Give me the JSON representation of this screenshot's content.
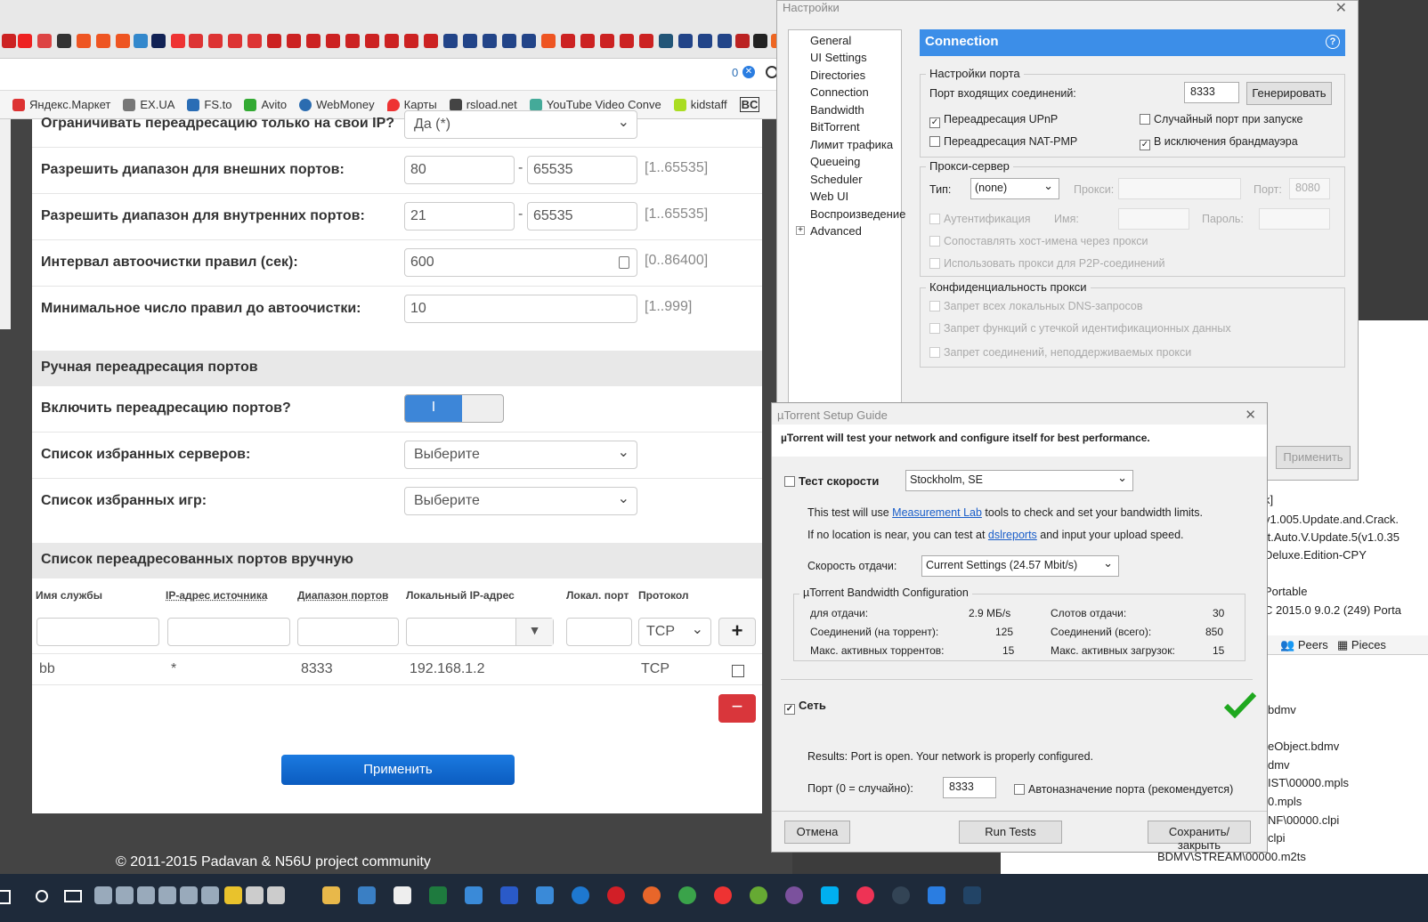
{
  "browser": {
    "counter": "0",
    "bookmarks": [
      {
        "label": "Яндекс.Маркет",
        "color": "#d33"
      },
      {
        "label": "EX.UA",
        "color": "#777"
      },
      {
        "label": "FS.to",
        "color": "#2a6db5"
      },
      {
        "label": "Avito",
        "color": "#3a3"
      },
      {
        "label": "WebMoney",
        "color": "#2b6cb0"
      },
      {
        "label": "Карты",
        "color": "#e33"
      },
      {
        "label": "rsload.net",
        "color": "#444"
      },
      {
        "label": "YouTube Video Conve",
        "color": "#4a9"
      },
      {
        "label": "kidstaff",
        "color": "#ad2"
      },
      {
        "label": "BC",
        "color": "#333"
      }
    ]
  },
  "router": {
    "row_restrict": {
      "label": "Ограничивать переадресацию только на свои IP?",
      "value": "Да (*)"
    },
    "row_ext": {
      "label": "Разрешить диапазон для внешних портов:",
      "from": "80",
      "to": "65535",
      "range": "[1..65535]"
    },
    "row_int": {
      "label": "Разрешить диапазон для внутренних портов:",
      "from": "21",
      "to": "65535",
      "range": "[1..65535]"
    },
    "row_interval": {
      "label": "Интервал автоочистки правил (сек):",
      "value": "600",
      "range": "[0..86400]"
    },
    "row_min": {
      "label": "Минимальное число правил до автоочистки:",
      "value": "10",
      "range": "[1..999]"
    },
    "section_manual": "Ручная переадресация портов",
    "row_enable": {
      "label": "Включить переадресацию портов?",
      "toggle": "I"
    },
    "row_servers": {
      "label": "Список избранных серверов:",
      "value": "Выберите"
    },
    "row_games": {
      "label": "Список избранных игр:",
      "value": "Выберите"
    },
    "section_list": "Список переадресованных портов вручную",
    "columns": [
      "Имя службы",
      "IP-адрес источника",
      "Диапазон портов",
      "Локальный IP-адрес",
      "Локал. порт",
      "Протокол"
    ],
    "new_protocol": "TCP",
    "entry": {
      "name": "bb",
      "src": "*",
      "range": "8333",
      "local_ip": "192.168.1.2",
      "protocol": "TCP"
    },
    "apply": "Применить",
    "footer": "© 2011-2015 Padavan & N56U project community"
  },
  "settings": {
    "title": "Настройки",
    "tree": [
      "General",
      "UI Settings",
      "Directories",
      "Connection",
      "Bandwidth",
      "BitTorrent",
      "Лимит трафика",
      "Queueing",
      "Scheduler",
      "Web UI",
      "Воспроизведение",
      "Advanced"
    ],
    "header": "Connection",
    "port_group": "Настройки порта",
    "incoming_label": "Порт входящих соединений:",
    "incoming_value": "8333",
    "generate": "Генерировать",
    "upnp": "Переадресация UPnP",
    "random_port": "Случайный порт при запуске",
    "natpmp": "Переадресация NAT-PMP",
    "firewall": "В исключения брандмауэра",
    "proxy_group": "Прокси-сервер",
    "type_label": "Тип:",
    "type_value": "(none)",
    "proxy_label": "Прокси:",
    "port_label": "Порт:",
    "port_value": "8080",
    "auth": "Аутентификация",
    "name_label": "Имя:",
    "pass_label": "Пароль:",
    "hostnames": "Сопоставлять хост-имена через прокси",
    "p2p": "Использовать прокси для P2P-соединений",
    "privacy_group": "Конфиденциальность прокси",
    "dns": "Запрет всех локальных DNS-запросов",
    "leak": "Запрет функций с утечкой идентификационных данных",
    "unsupported": "Запрет соединений, неподдерживаемых прокси",
    "apply": "Применить"
  },
  "behind": {
    "lines": [
      "k]",
      "v1.005.Update.and.Crack.",
      "ft.Auto.V.Update.5(v1.0.35",
      "Deluxe.Edition-CPY",
      "Portable",
      "C 2015.0 9.0.2 (249) Porta"
    ],
    "tabs": [
      "Peers",
      "Pieces"
    ],
    "files": [
      "bdmv",
      "eObject.bdmv",
      "dmv",
      "IST\\00000.mpls",
      "0.mpls",
      "NF\\00000.clpi",
      "clpi",
      "BDMV\\STREAM\\00000.m2ts"
    ]
  },
  "guide": {
    "title": "µTorrent Setup Guide",
    "heading": "µTorrent will test your network and configure itself for best performance.",
    "speed_test": "Тест скорости",
    "location": "Stockholm, SE",
    "info1a": "This test will use ",
    "info1link": "Measurement Lab",
    "info1b": " tools to check and set your bandwidth limits.",
    "info2a": "If no location is near, you can test at ",
    "info2link": "dslreports",
    "info2b": " and input your upload speed.",
    "upload_label": "Скорость отдачи:",
    "upload_value": "Current Settings (24.57 Mbit/s)",
    "bw_group": "µTorrent Bandwidth Configuration",
    "bw": [
      {
        "l": "для отдачи:",
        "v": "2.9 МБ/s",
        "l2": "Слотов отдачи:",
        "v2": "30"
      },
      {
        "l": "Соединений (на торрент):",
        "v": "125",
        "l2": "Соединений (всего):",
        "v2": "850"
      },
      {
        "l": "Макс. активных торрентов:",
        "v": "15",
        "l2": "Макс. активных загрузок:",
        "v2": "15"
      }
    ],
    "network": "Сеть",
    "results": "Results: Port is open. Your network is properly configured.",
    "port_label": "Порт (0 = случайно):",
    "port_value": "8333",
    "auto_port": "Автоназначение порта (рекомендуется)",
    "cancel": "Отмена",
    "run": "Run Tests",
    "save": "Сохранить/закрыть",
    "check_color": "#1fa81f"
  }
}
